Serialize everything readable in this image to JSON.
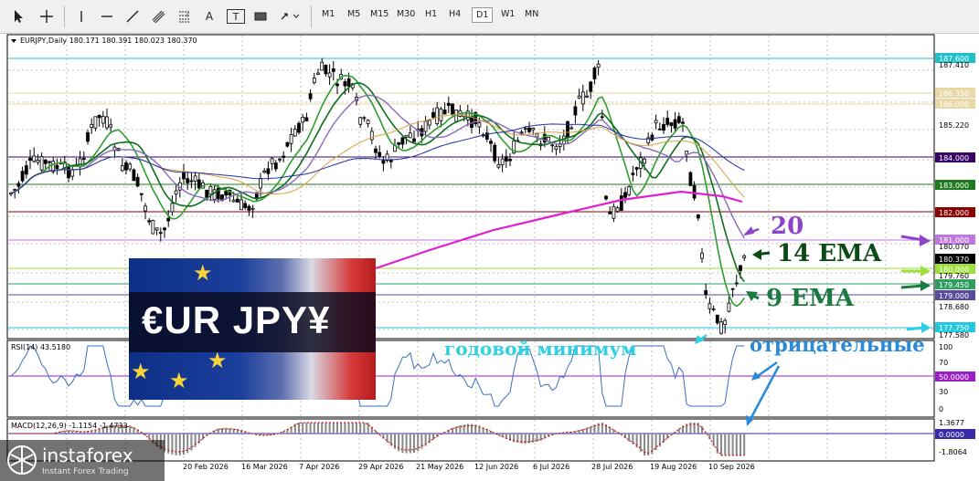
{
  "toolbar": {
    "drawing_tools": [
      "cursor-icon",
      "crosshair-icon",
      "vertical-line-icon",
      "horizontal-line-icon",
      "trendline-icon",
      "channel-icon",
      "fibonacci-icon",
      "text-icon",
      "text-label-icon",
      "rectangle-icon",
      "arrow-icon"
    ],
    "text_tool_label": "A",
    "label_tool_label": "T",
    "timeframes": [
      "M1",
      "M5",
      "M15",
      "M30",
      "H1",
      "H4",
      "D1",
      "W1",
      "MN"
    ],
    "active_timeframe": "D1"
  },
  "chart": {
    "header": "EURJPY,Daily  180.171 180.391 180.023 180.370",
    "rsi_label": "RSI(14) 43.5180",
    "macd_label": "MACD(12,26,9) -1.1154 -1.4733",
    "price_axis": [
      "187.600",
      "187.410",
      "186.350",
      "186.000",
      "185.220",
      "184.000",
      "183.000",
      "182.000",
      "181.000",
      "180.070",
      "180.370",
      "180.000",
      "179.760",
      "179.450",
      "179.000",
      "178.680",
      "177.750",
      "177.580"
    ],
    "rsi_axis": [
      "100",
      "70",
      "50.0000",
      "30",
      "0"
    ],
    "macd_axis": [
      "1.3677",
      "0.0000",
      "-1.8064"
    ],
    "dates": [
      "20 Feb 2026",
      "16 Mar 2026",
      "7 Apr 2026",
      "29 Apr 2026",
      "21 May 2026",
      "12 Jun 2026",
      "6 Jul 2026",
      "28 Jul 2026",
      "19 Aug 2026",
      "10 Sep 2026"
    ],
    "colors": {
      "bull": "#000000",
      "bear": "#000000",
      "ema9": "#2e9e2e",
      "ema14": "#0e6e1e",
      "ema20": "#8a6bb8",
      "ema200": "#e020d0",
      "rsi": "#3a6fc4",
      "macd_hist": "#888888",
      "signal": "#cc0000"
    }
  },
  "annotations": {
    "ema20": "20",
    "ema14": "14 EMA",
    "ema9": "9 EMA",
    "yearly_min": "годовой минимум",
    "negative": "отрицательные"
  },
  "banner": {
    "pair": "€UR JPY¥"
  },
  "brand": {
    "name": "instaforex",
    "tagline": "Instant Forex Trading"
  }
}
